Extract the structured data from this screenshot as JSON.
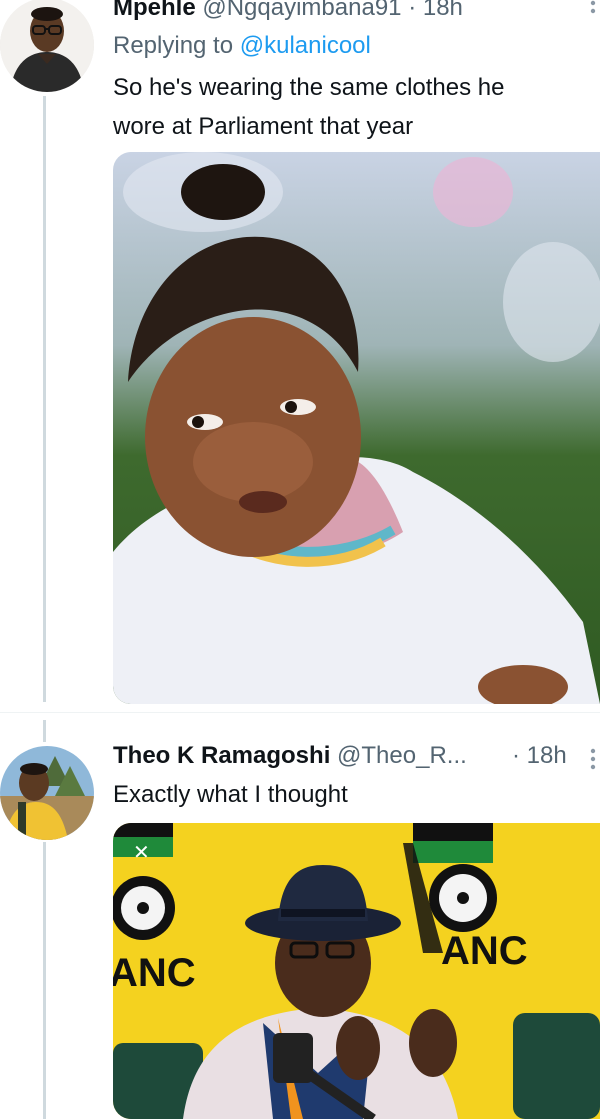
{
  "tweets": [
    {
      "author_name": "Mpehle",
      "handle": "@Ngqayimbana91",
      "separator": "·",
      "time": "18h",
      "replying_prefix": "Replying to ",
      "replying_to": "@kulanicool",
      "text_line1": "So he's wearing the same clothes he",
      "text_line2": "wore at Parliament that year",
      "media_icon": "photo-child-portrait",
      "more_icon": "more-vertical-icon"
    },
    {
      "author_name": "Theo K Ramagoshi",
      "handle": "@Theo_R...",
      "separator": "·",
      "time": "18h",
      "text": "Exactly what I thought",
      "media_banner_left": "ANC",
      "media_banner_right": "ANC",
      "media_icon": "photo-man-press-conference",
      "more_icon": "more-vertical-icon"
    }
  ],
  "colors": {
    "link": "#1d9bf0",
    "secondary_text": "#536471",
    "thread_line": "#cfd9de",
    "anc_yellow": "#f4d21f",
    "anc_green": "#1f8a3a"
  }
}
